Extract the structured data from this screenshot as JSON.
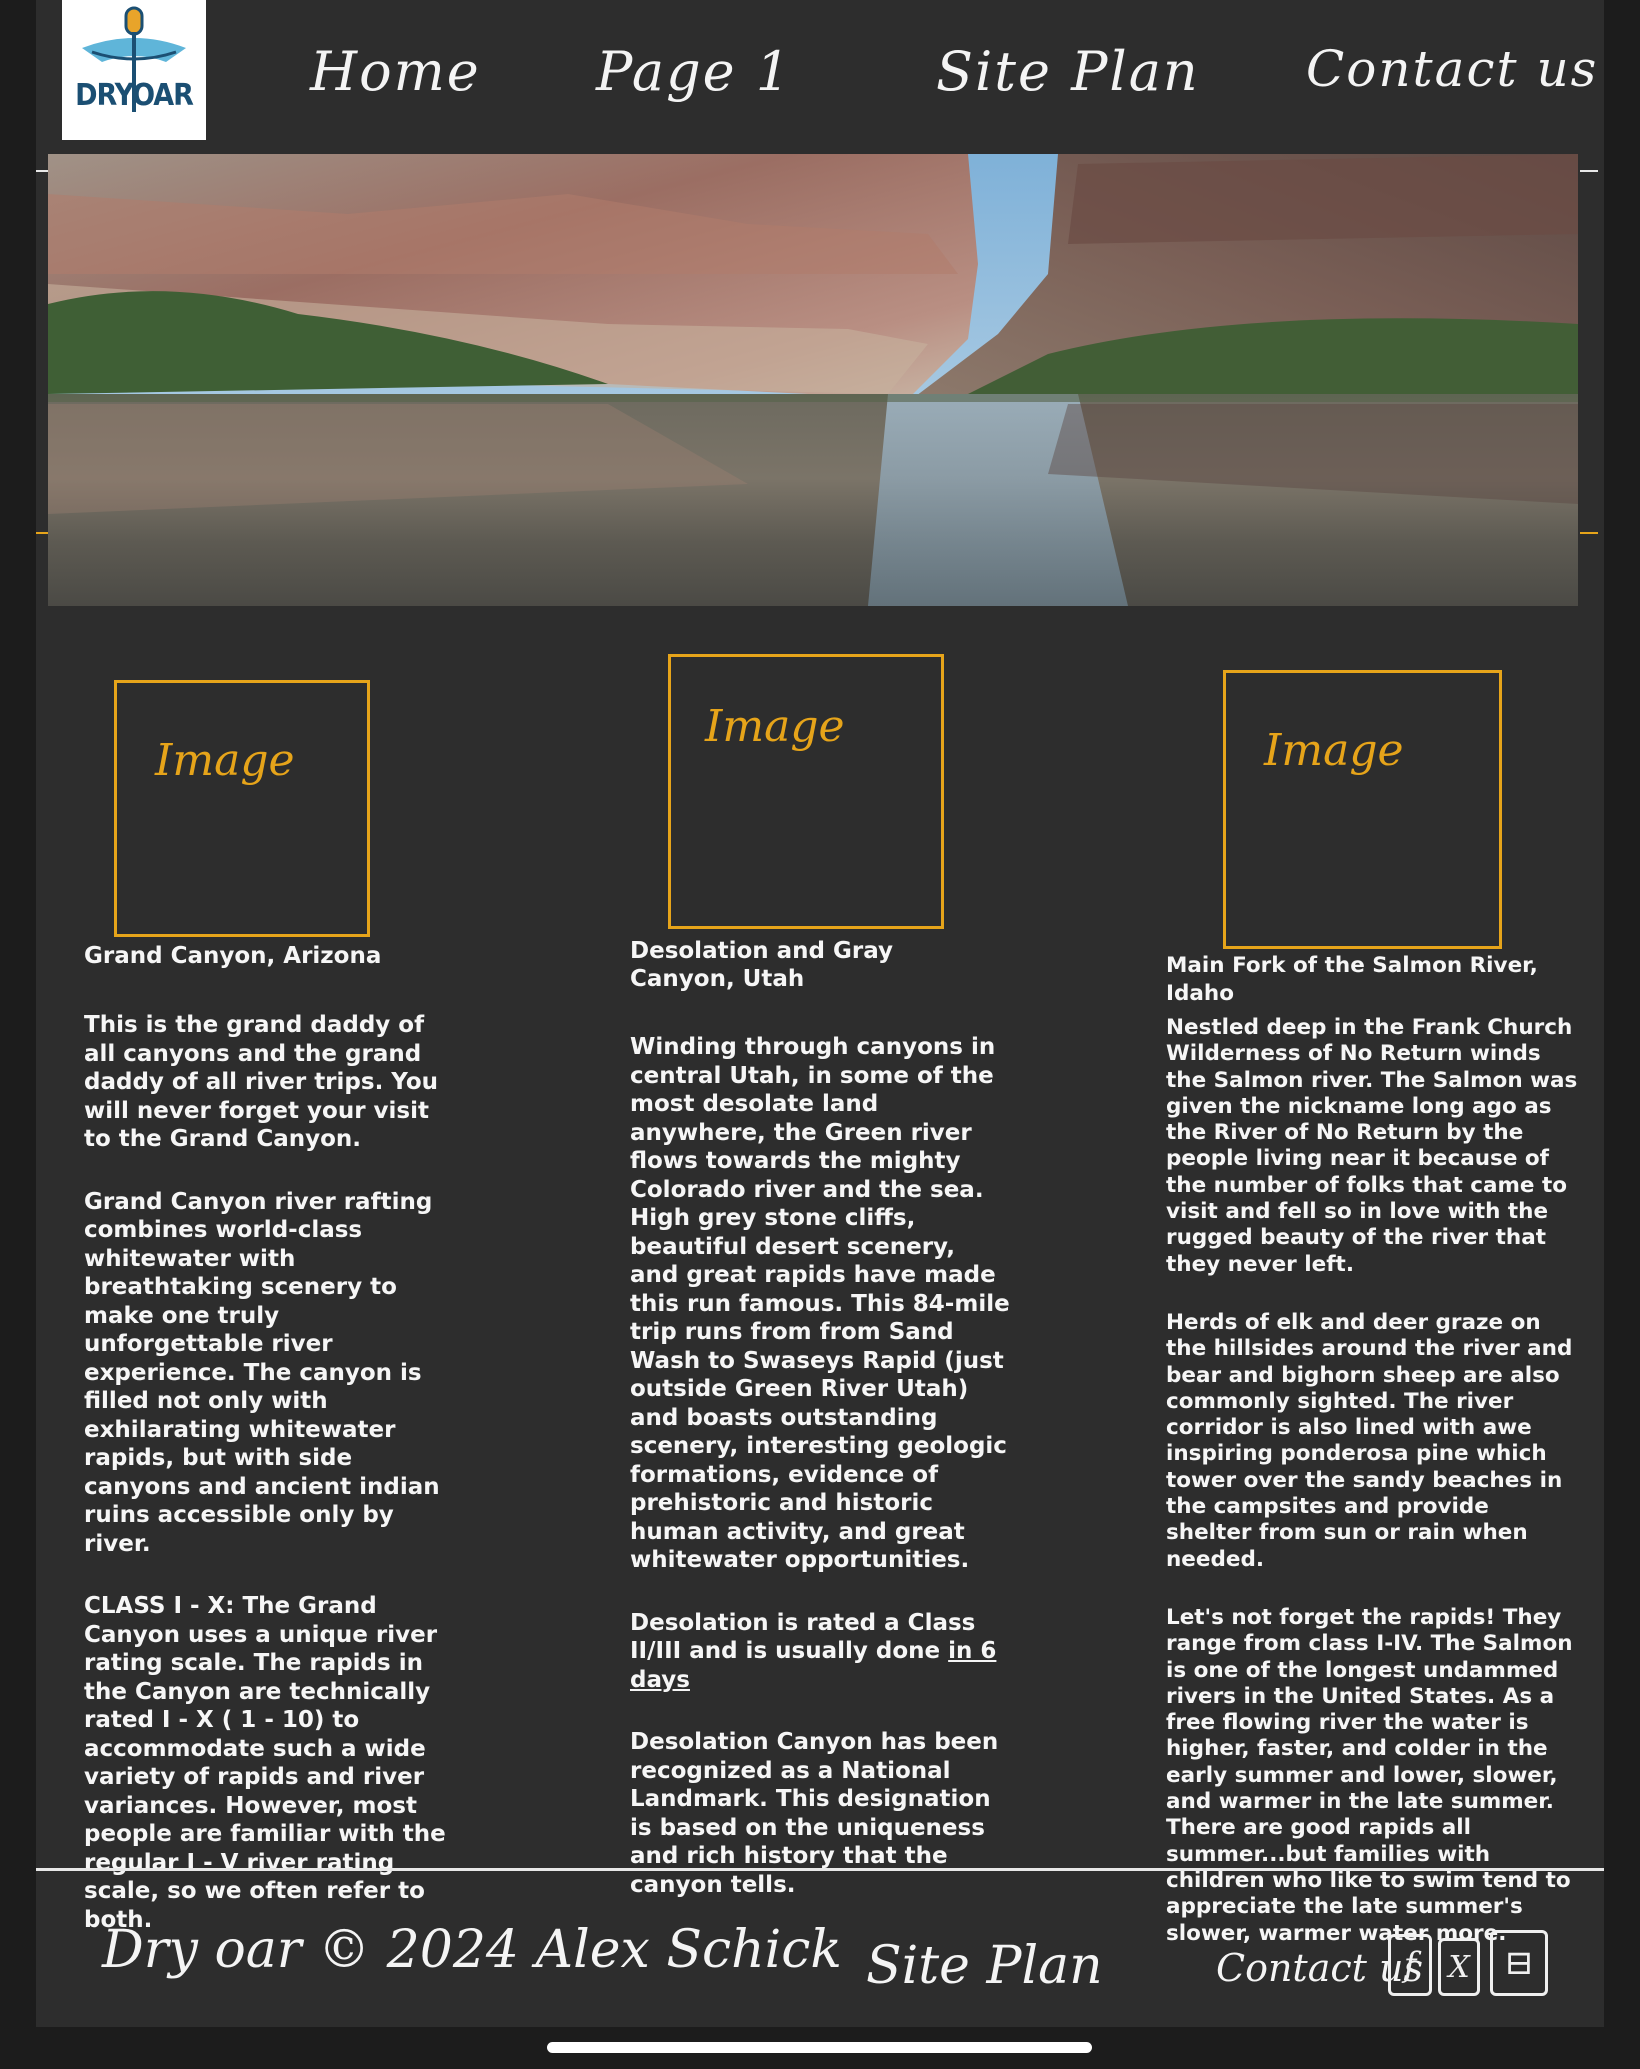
{
  "header": {
    "logo_text": "DRYOAR",
    "nav": [
      "Home",
      "Page 1",
      "Site Plan",
      "Contact us"
    ]
  },
  "columns": [
    {
      "placeholder": "Image",
      "title": "Grand Canyon, Arizona",
      "paragraphs": [
        "This is the grand daddy of all canyons and the grand daddy of all river trips. You will never forget your visit to the Grand Canyon.",
        "Grand Canyon river rafting combines world-class whitewater with breathtaking scenery to make one truly unforgettable river experience. The canyon is filled not only with exhilarating whitewater rapids, but with side canyons and ancient indian ruins accessible only by river.",
        "CLASS I - X: The Grand Canyon uses a unique river rating scale. The rapids in the Canyon are technically rated I - X ( 1 - 10) to accommodate such a wide variety of rapids and river variances. However, most people are familiar with the regular I - V river rating scale, so we often refer to both."
      ]
    },
    {
      "placeholder": "Image",
      "title": "Desolation and Gray Canyon, Utah",
      "paragraphs": [
        "Winding through canyons in central Utah, in some of the most desolate land anywhere, the Green river flows towards the mighty Colorado river and the sea. High grey stone cliffs, beautiful desert scenery, and great rapids have made this run famous. This 84-mile trip runs from from Sand Wash to Swaseys Rapid (just outside Green River Utah) and boasts outstanding scenery, interesting geologic formations, evidence of prehistoric and historic human activity, and great whitewater opportunities.",
        "Desolation is rated a Class II/III and is usually done ",
        "Desolation Canyon has been recognized as a National Landmark.  This designation is based on the uniqueness and rich history that the canyon tells."
      ],
      "link_text": "in 6 days"
    },
    {
      "placeholder": "Image",
      "title": "Main Fork of the Salmon River, Idaho",
      "paragraphs": [
        "Nestled deep in the Frank Church Wilderness of No Return winds the Salmon river. The Salmon was given the nickname long ago as the River of No Return by the people living near it because of the number of folks that came to visit and fell so in love with the rugged beauty of the river that they never left.",
        "Herds of elk and deer graze on the hillsides around the river and bear and bighorn sheep are also commonly sighted. The river corridor is also lined with awe inspiring ponderosa pine which tower over the sandy beaches in the campsites and provide shelter from sun or rain when needed.",
        "Let's not forget the rapids! They range from class I-IV. The Salmon is one of the longest undammed rivers in the United States. As a free flowing river the water is higher, faster, and colder in the early summer and lower, slower, and warmer in the late summer. There are good rapids all summer...but families with children who like to swim tend to appreciate the late summer's slower, warmer water more."
      ]
    }
  ],
  "footer": {
    "copyright": "Dry oar © 2024 Alex Schick",
    "site_plan": "Site Plan",
    "contact": "Contact us",
    "social": [
      "f",
      "X",
      "⊟"
    ]
  },
  "colors": {
    "accent": "#e6a41a",
    "background": "#2d2d2d",
    "text": "#f6f6f6"
  }
}
